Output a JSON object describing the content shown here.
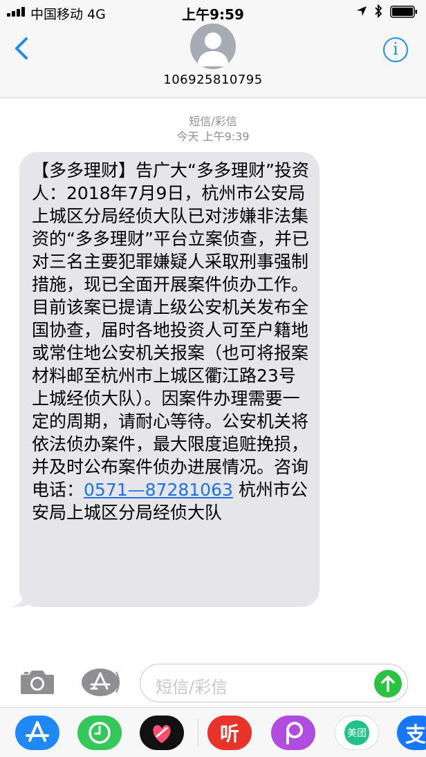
{
  "status_bar": {
    "carrier": "中国移动  4G",
    "time": "上午9:59"
  },
  "header": {
    "contact": "106925810795",
    "info_glyph": "i"
  },
  "conversation": {
    "service": "短信/彩信",
    "timestamp": "今天 上午9:39"
  },
  "message": {
    "text_before": "【多多理财】告广大“多多理财”投资人：2018年7月9日，杭州市公安局上城区分局经侦大队已对涉嫌非法集资的“多多理财”平台立案侦查，并已对三名主要犯罪嫌疑人采取刑事强制措施，现已全面开展案件侦办工作。目前该案已提请上级公安机关发布全国协查，届时各地投资人可至户籍地或常住地公安机关报案（也可将报案材料邮至杭州市上城区衢江路23号上城经侦大队）。因案件办理需要一定的周期，请耐心等待。公安机关将依法侦办案件，最大限度追赃挽损，并及时公布案件侦办进展情况。咨询电话：",
    "phone": "0571—87281063",
    "text_after": " 杭州市公安局上城区分局经侦大队"
  },
  "compose": {
    "placeholder": "短信/彩信"
  },
  "app_drawer": {
    "apps": [
      {
        "name": "app-store",
        "color": "#1e88f5"
      },
      {
        "name": "clock",
        "color": "#34c759"
      },
      {
        "name": "heart-app",
        "color": "#111111"
      },
      {
        "name": "ting-app",
        "color": "#e8332a",
        "label": "听"
      },
      {
        "name": "picsart",
        "color": "#b04de0"
      },
      {
        "name": "meituan",
        "color": "#ffffff",
        "label": "美团"
      },
      {
        "name": "alipay",
        "color": "#1677ff",
        "label": "支"
      }
    ]
  },
  "colors": {
    "ios_blue": "#1a8df5",
    "bubble_gray": "#e5e5ea",
    "send_green": "#29c340",
    "link_blue": "#1a73e8"
  }
}
